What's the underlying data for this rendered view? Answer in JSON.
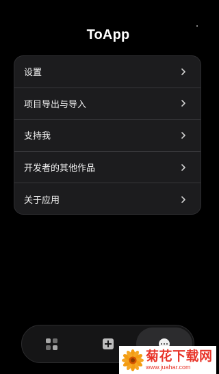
{
  "header": {
    "title": "ToApp"
  },
  "menu": {
    "items": [
      {
        "label": "设置",
        "icon": "chevron-right-icon"
      },
      {
        "label": "项目导出与导入",
        "icon": "chevron-right-icon"
      },
      {
        "label": "支持我",
        "icon": "chevron-right-icon"
      },
      {
        "label": "开发者的其他作品",
        "icon": "chevron-right-icon"
      },
      {
        "label": "关于应用",
        "icon": "chevron-right-icon"
      }
    ]
  },
  "bottom_nav": {
    "tabs": [
      {
        "icon": "grid-icon",
        "selected": false
      },
      {
        "icon": "add-square-icon",
        "selected": false
      },
      {
        "icon": "more-icon",
        "selected": true
      }
    ]
  },
  "watermark": {
    "name": "菊花下载网",
    "url": "www.juahar.com",
    "icon": "flower-logo-icon"
  },
  "colors": {
    "background": "#000000",
    "card": "#1c1c1e",
    "divider": "#38383b",
    "watermark_red": "#e8352a"
  }
}
